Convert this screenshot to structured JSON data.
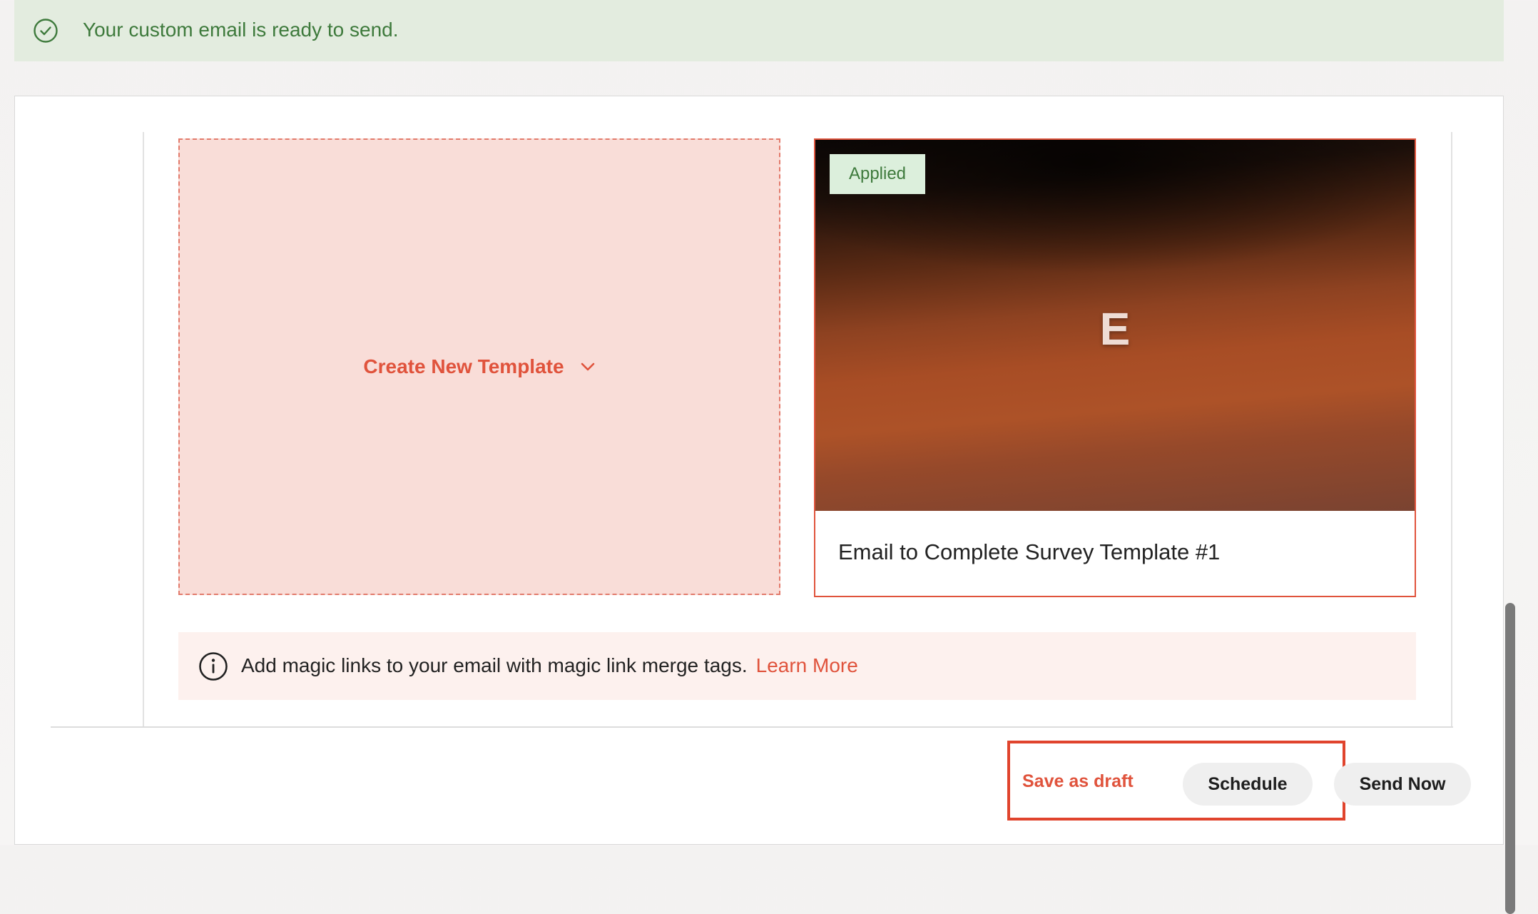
{
  "banner": {
    "message": "Your custom email is ready to send.",
    "icon": "check-circle-icon",
    "color": "#3e7a3c"
  },
  "create_template": {
    "label": "Create New Template",
    "icon": "chevron-down-icon"
  },
  "template_card": {
    "badge": "Applied",
    "thumbnail_letter": "E",
    "title": "Email to Complete Survey Template #1"
  },
  "info": {
    "icon": "info-icon",
    "text": "Add magic links to your email with magic link merge tags.",
    "link": "Learn More"
  },
  "actions": {
    "save_draft": "Save as draft",
    "schedule": "Schedule",
    "send_now": "Send Now"
  },
  "colors": {
    "accent": "#e0533c",
    "success": "#3e7a3c",
    "success_bg": "#e3ecdf",
    "create_card_bg": "#f9ddd8",
    "info_bg": "#fdf1ee"
  }
}
